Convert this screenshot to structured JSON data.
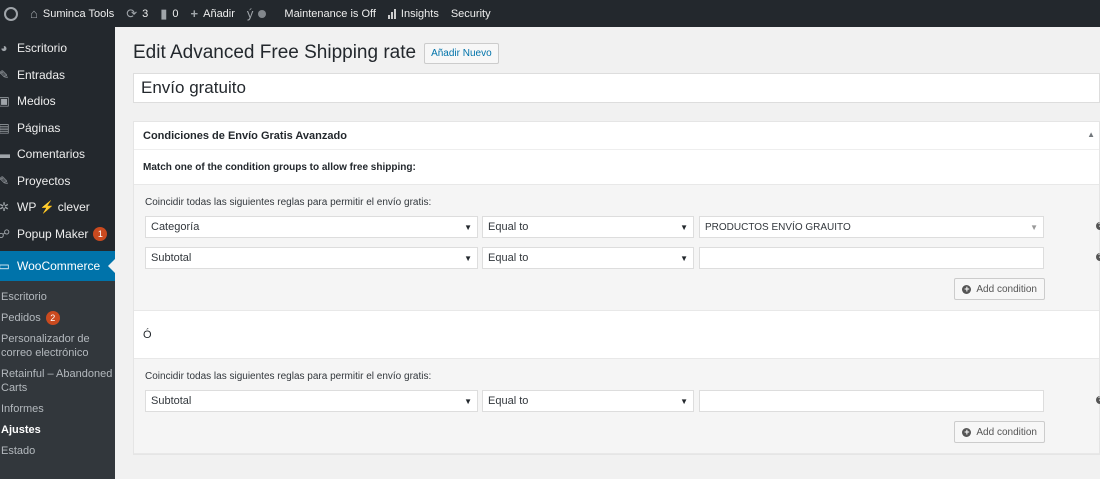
{
  "adminbar": {
    "site_name": "Suminca Tools",
    "updates_count": "3",
    "comments_count": "0",
    "add_new": "Añadir",
    "maintenance": "Maintenance is Off",
    "insights": "Insights",
    "security": "Security"
  },
  "sidebar": {
    "items": [
      {
        "label": "Escritorio",
        "icon": "dashboard-icon"
      },
      {
        "label": "Entradas",
        "icon": "pin-icon"
      },
      {
        "label": "Medios",
        "icon": "media-icon"
      },
      {
        "label": "Páginas",
        "icon": "pages-icon"
      },
      {
        "label": "Comentarios",
        "icon": "comment-icon"
      },
      {
        "label": "Proyectos",
        "icon": "pin-icon"
      },
      {
        "label": "WP ⚡ clever",
        "icon": "gear-icon"
      },
      {
        "label": "Popup Maker",
        "icon": "popup-icon",
        "badge": "1"
      },
      {
        "label": "WooCommerce",
        "icon": "woo-icon"
      }
    ],
    "submenu": [
      {
        "label": "Escritorio"
      },
      {
        "label": "Pedidos",
        "badge": "2"
      },
      {
        "label": "Personalizador de correo electrónico"
      },
      {
        "label": "Retainful – Abandoned Carts"
      },
      {
        "label": "Informes"
      },
      {
        "label": "Ajustes"
      },
      {
        "label": "Estado"
      }
    ]
  },
  "main": {
    "title": "Edit Advanced Free Shipping rate",
    "add_new": "Añadir Nuevo",
    "post_title": "Envío gratuito",
    "postbox_title": "Condiciones de Envío Gratis Avanzado",
    "match_text": "Match one of the condition groups to allow free shipping:",
    "or_label": "Ó",
    "groups": [
      {
        "title": "Coincidir todas las siguientes reglas para permitir el envío gratis:",
        "rules": [
          {
            "condition": "Categoría",
            "operator": "Equal to",
            "value": "PRODUCTOS ENVÍO GRAUITO"
          },
          {
            "condition": "Subtotal",
            "operator": "Equal to",
            "value": ""
          }
        ],
        "add_condition": "Add condition"
      },
      {
        "title": "Coincidir todas las siguientes reglas para permitir el envío gratis:",
        "rules": [
          {
            "condition": "Subtotal",
            "operator": "Equal to",
            "value": ""
          }
        ],
        "add_condition": "Add condition"
      }
    ]
  }
}
